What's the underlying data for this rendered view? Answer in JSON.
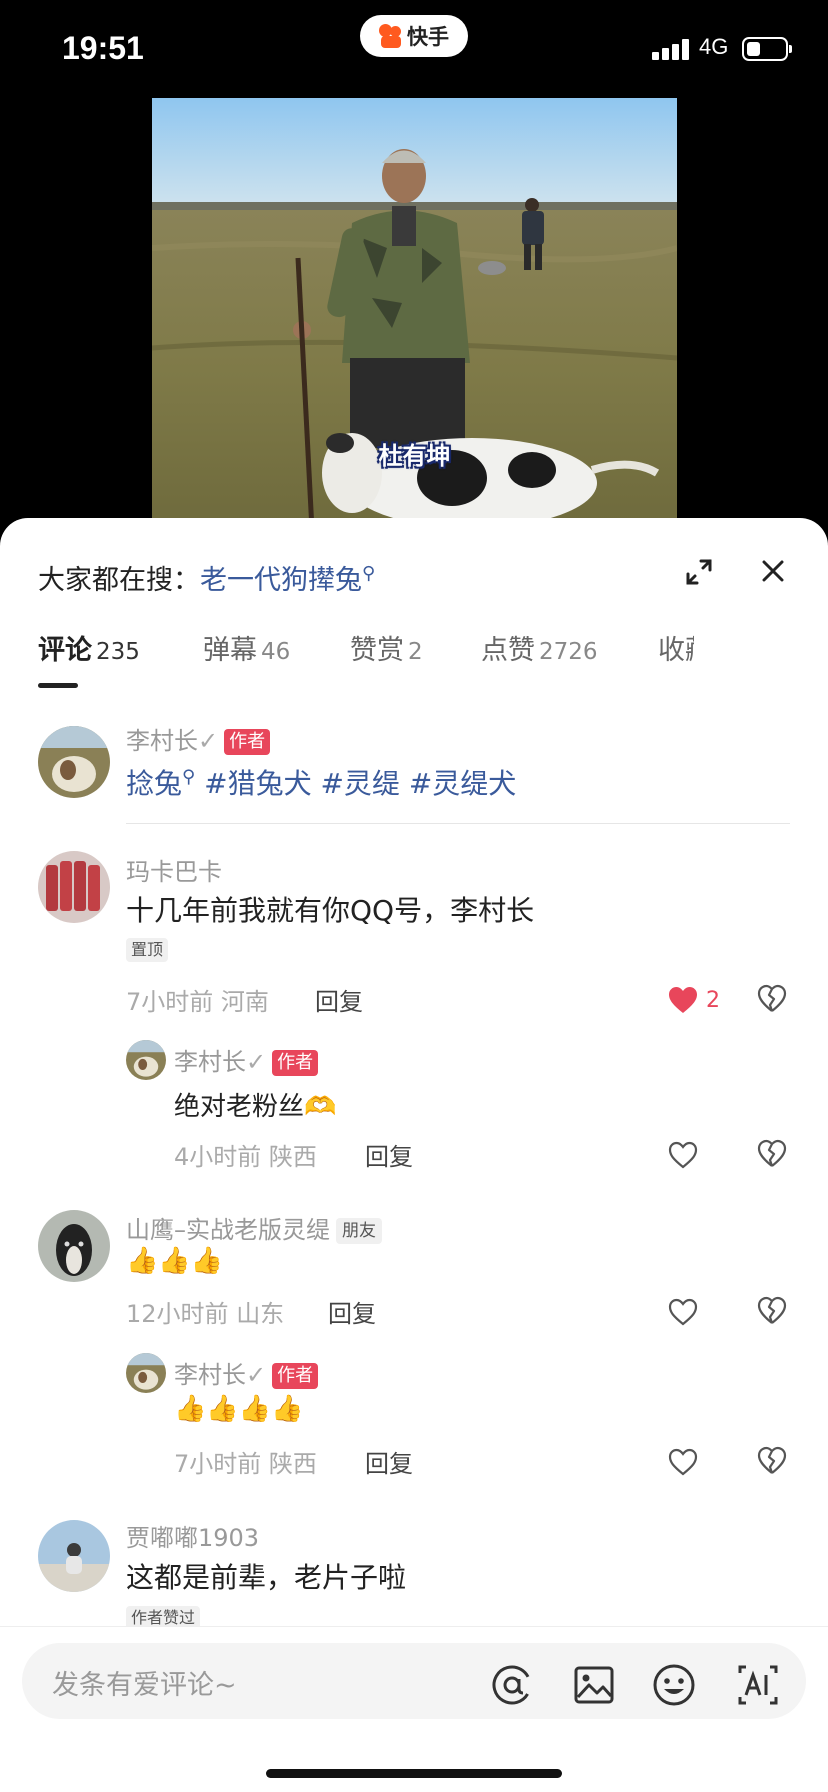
{
  "status": {
    "time": "19:51",
    "app_name": "快手",
    "network": "4G",
    "battery_fraction": 0.35
  },
  "video": {
    "caption": "杜有坤"
  },
  "search": {
    "prefix": "大家都在搜：",
    "keyword": "老一代狗撵兔"
  },
  "tabs": [
    {
      "label": "评论",
      "count": "235"
    },
    {
      "label": "弹幕",
      "count": "46"
    },
    {
      "label": "赞赏",
      "count": "2"
    },
    {
      "label": "点赞",
      "count": "2726"
    },
    {
      "label": "收藏",
      "count": ""
    }
  ],
  "author_post": {
    "username": "李村长",
    "badge": "作者",
    "text_keyword": "捻兔",
    "tags": "#猎兔犬 #灵缇 #灵缇犬"
  },
  "comments": [
    {
      "username": "玛卡巴卡",
      "text": "十几年前我就有你QQ号，李村长",
      "pinned": "置顶",
      "time": "7小时前",
      "location": "河南",
      "reply": "回复",
      "likes": "2",
      "reply_item": {
        "username": "李村长",
        "badge": "作者",
        "text": "绝对老粉丝",
        "emoji": "🫶",
        "time": "4小时前",
        "location": "陕西",
        "reply": "回复"
      }
    },
    {
      "username": "山鹰–实战老版灵缇",
      "badge": "朋友",
      "emoji": "👍👍👍",
      "time": "12小时前",
      "location": "山东",
      "reply": "回复",
      "reply_item": {
        "username": "李村长",
        "badge": "作者",
        "emoji": "👍👍👍👍",
        "time": "7小时前",
        "location": "陕西",
        "reply": "回复"
      }
    },
    {
      "username": "贾嘟嘟1903",
      "text": "这都是前辈，老片子啦",
      "tag": "作者赞过"
    }
  ],
  "input": {
    "placeholder": "发条有爱评论~"
  },
  "colors": {
    "accent": "#e8465b",
    "link": "#3a5a9b",
    "brand": "#ff5a1f"
  },
  "icons": [
    "expand-icon",
    "close-icon",
    "heart-icon",
    "heart-outline-icon",
    "broken-heart-icon",
    "at-icon",
    "image-icon",
    "emoji-icon",
    "ai-icon"
  ]
}
